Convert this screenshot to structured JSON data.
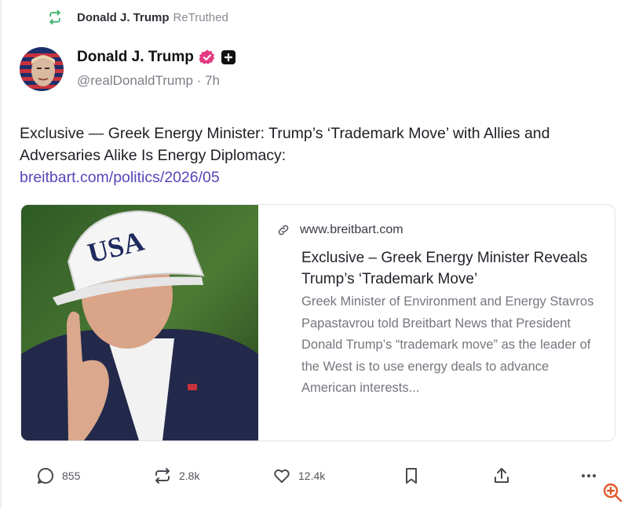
{
  "retruth": {
    "name": "Donald J. Trump",
    "label": "ReTruthed",
    "icon": "retruth-icon",
    "accent": "#3bb36b"
  },
  "author": {
    "name": "Donald J. Trump",
    "handle": "@realDonaldTrump",
    "separator": "·",
    "time": "7h",
    "verified_color": "#e23b84"
  },
  "post": {
    "text": "Exclusive — Greek Energy Minister: Trump’s ‘Trademark Move’ with Allies and Adversaries Alike Is Energy Diplomacy:",
    "link": "breitbart.com/politics/2026/05",
    "link_color": "#5447b8"
  },
  "card": {
    "domain": "www.breitbart.com",
    "title": "Exclusive – Greek Energy Minister Reveals Trump’s ‘Trademark Move’",
    "description": "Greek Minister of Environment and Energy Stavros Papastavrou told Breitbart News that President Donald Trump’s “trademark move” as the leader of the West is to use energy deals to advance American interests...",
    "image_hat_text": "USA"
  },
  "actions": {
    "replies": "855",
    "retruths": "2.8k",
    "likes": "12.4k"
  },
  "icons": [
    "retruth-icon",
    "verified-icon",
    "plus-badge-icon",
    "link-icon",
    "reply-icon",
    "retruth-action-icon",
    "like-icon",
    "bookmark-icon",
    "share-icon",
    "more-icon",
    "zoom-icon"
  ]
}
